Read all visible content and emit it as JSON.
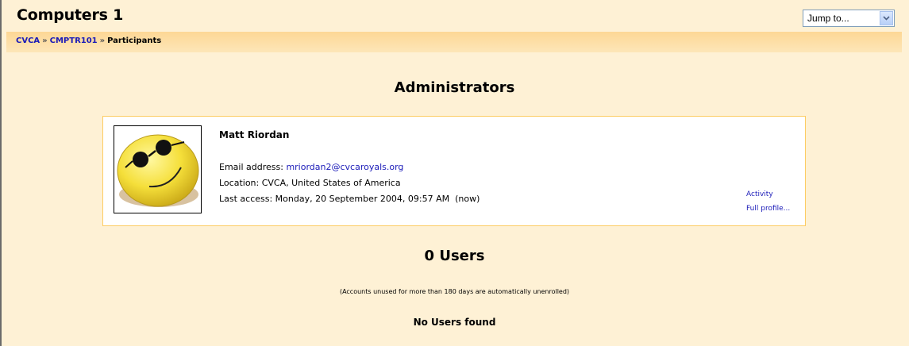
{
  "header": {
    "course_title": "Computers 1",
    "jump_label": "Jump to...",
    "breadcrumb": [
      {
        "label": "CVCA",
        "link": true
      },
      {
        "label": "CMPTR101",
        "link": true
      },
      {
        "label": "Participants",
        "link": false
      }
    ],
    "separator": "»"
  },
  "administrators": {
    "heading": "Administrators",
    "user": {
      "name": "Matt Riordan",
      "email_label": "Email address:",
      "email": "mriordan2@cvcaroyals.org",
      "location": "Location: CVCA, United States of America",
      "last_access": "Last access: Monday, 20 September 2004, 09:57 AM  (now)",
      "activity_link": "Activity",
      "profile_link": "Full profile..."
    }
  },
  "users": {
    "heading": "0 Users",
    "note": "(Accounts unused for more than 180 days are automatically unenrolled)",
    "empty_message": "No Users found"
  },
  "colors": {
    "page_bg": "#fef1d5",
    "navbar": "#fdd795",
    "link": "#1a1ab8",
    "card_border": "#fccc63"
  }
}
